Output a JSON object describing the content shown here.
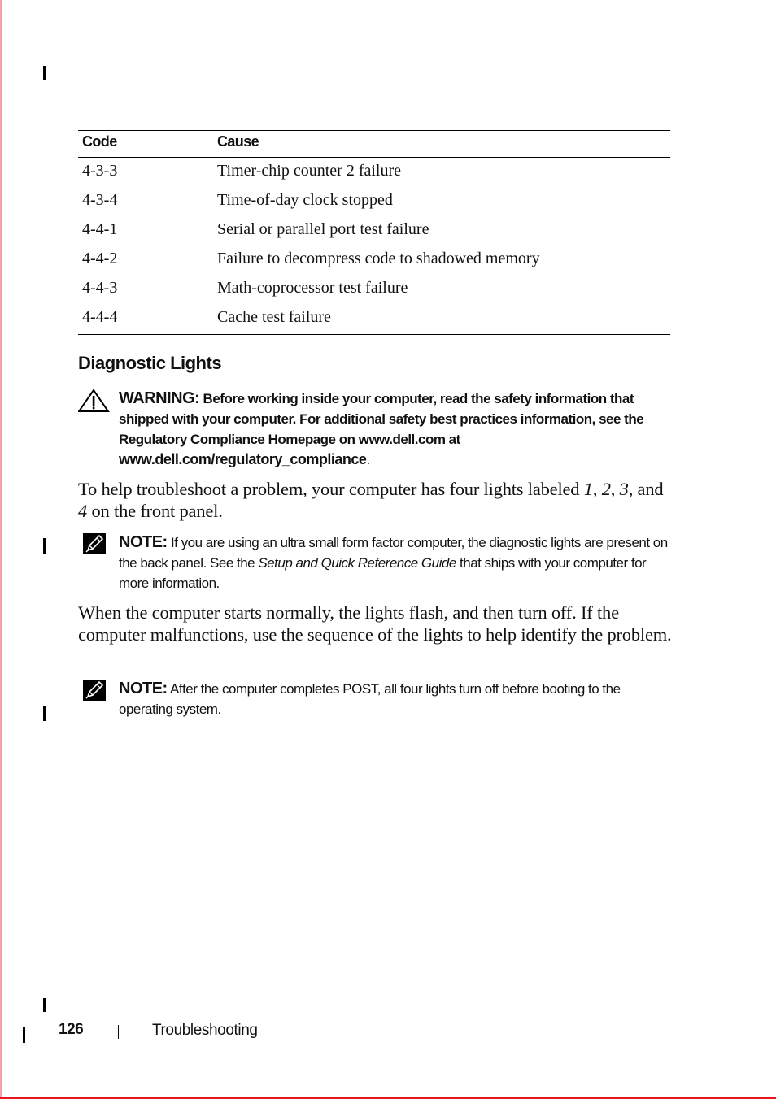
{
  "table": {
    "headers": [
      "Code",
      "Cause"
    ],
    "rows": [
      {
        "code": "4-3-3",
        "cause": "Timer-chip counter 2 failure"
      },
      {
        "code": "4-3-4",
        "cause": "Time-of-day clock stopped"
      },
      {
        "code": "4-4-1",
        "cause": "Serial or parallel port test failure"
      },
      {
        "code": "4-4-2",
        "cause": "Failure to decompress code to shadowed memory"
      },
      {
        "code": "4-4-3",
        "cause": "Math-coprocessor test failure"
      },
      {
        "code": "4-4-4",
        "cause": "Cache test failure"
      }
    ]
  },
  "section": {
    "title": "Diagnostic Lights"
  },
  "warning": {
    "icon": "warning-triangle-icon",
    "label": "WARNING:",
    "text": " Before working inside your computer, read the safety information that shipped with your computer. For additional safety best practices information, see the Regulatory Compliance Homepage on www.dell.com at ",
    "link": "www.dell.com/regulatory_compliance",
    "end": "."
  },
  "para1": {
    "before": "To help troubleshoot a problem, your computer has four lights labeled ",
    "l1": "1",
    "sep1": ", ",
    "l2": "2",
    "sep2": ", ",
    "l3": "3",
    "sep3": ", and ",
    "l4": "4",
    "after": " on the front panel."
  },
  "note1": {
    "icon": "note-pencil-icon",
    "label": "NOTE:",
    "before": " If you are using an ultra small form factor computer, the diagnostic lights are present on the back panel. See the ",
    "italic": "Setup and Quick Reference Guide",
    "after": " that ships with your computer for more information."
  },
  "para2": {
    "text": "When the computer starts normally, the lights flash, and then turn off. If the computer malfunctions, use the sequence of the lights to help identify the problem."
  },
  "note2": {
    "icon": "note-pencil-icon",
    "label": "NOTE:",
    "text": " After the computer completes POST, all four lights turn off before booting to the operating system."
  },
  "footer": {
    "page_number": "126",
    "chapter": "Troubleshooting"
  }
}
